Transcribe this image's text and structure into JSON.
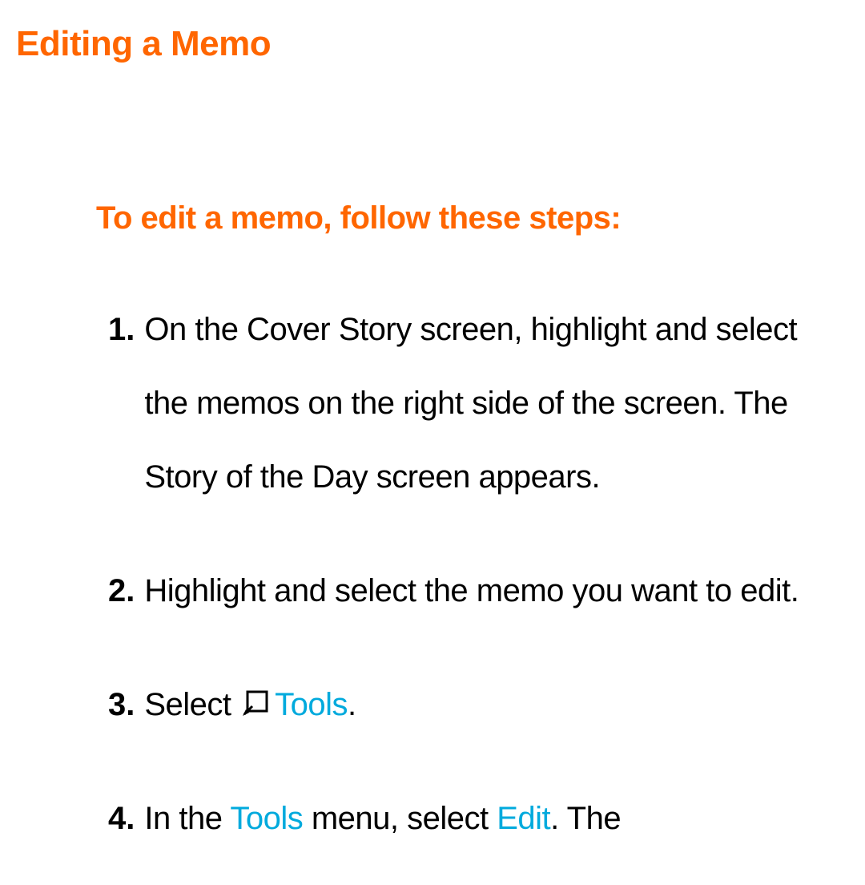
{
  "title": "Editing a Memo",
  "intro": "To edit a memo, follow these steps:",
  "steps": {
    "s1": {
      "num": "1.",
      "text": "On the Cover Story screen, highlight and select the memos on the right side of the screen. The Story of the Day screen appears."
    },
    "s2": {
      "num": "2.",
      "text": "Highlight and select the memo you want to edit."
    },
    "s3": {
      "num": "3.",
      "pre": "Select ",
      "tools": "Tools",
      "post": "."
    },
    "s4": {
      "num": "4.",
      "pre": "In the ",
      "tools": "Tools",
      "mid": " menu, select ",
      "edit": "Edit",
      "post": ". The"
    }
  }
}
